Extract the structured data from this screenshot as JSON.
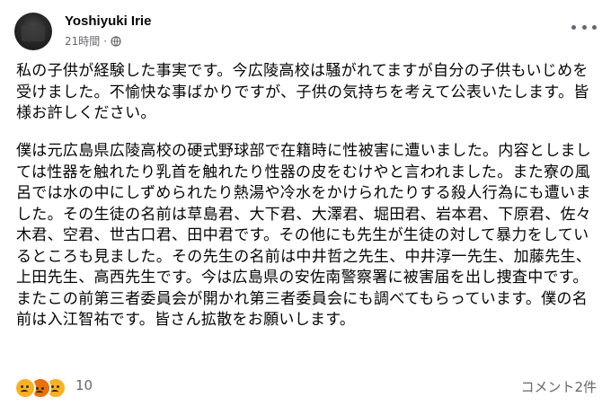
{
  "post": {
    "author": "Yoshiyuki Irie",
    "time": "21時間",
    "separator": "·",
    "privacy_icon": "globe-icon",
    "more_icon": "more-horizontal-icon",
    "paragraphs": [
      "私の子供が経験した事実です。今広陵高校は騒がれてますが自分の子供もいじめを受けました。不愉快な事ばかりですが、子供の気持ちを考えて公表いたします。皆様お許しください。",
      "僕は元広島県広陵高校の硬式野球部で在籍時に性被害に遭いました。内容としましては性器を触れたり乳首を触れたり性器の皮をむけやと言われました。また寮の風呂では水の中にしずめられたり熱湯や冷水をかけられたりする殺人行為にも遭いました。その生徒の名前は草島君、大下君、大澤君、堀田君、岩本君、下原君、佐々木君、空君、世古口君、田中君です。その他にも先生が生徒の対して暴力をしているところも見ました。その先生の名前は中井哲之先生、中井淳一先生、加藤先生、上田先生、高西先生です。今は広島県の安佐南警察署に被害届を出し捜査中です。またこの前第三者委員会が開かれ第三者委員会にも調べてもらっています。僕の名前は入江智祐です。皆さん拡散をお願いします。"
    ]
  },
  "footer": {
    "reaction_icons": [
      "sad-reaction-icon",
      "angry-reaction-icon",
      "cry-reaction-icon"
    ],
    "reaction_count": "10",
    "comments_label": "コメント2件"
  },
  "colors": {
    "text": "#050505",
    "secondary": "#65676b",
    "reaction_yellow": "#f7b125",
    "reaction_orange": "#e9710f"
  }
}
